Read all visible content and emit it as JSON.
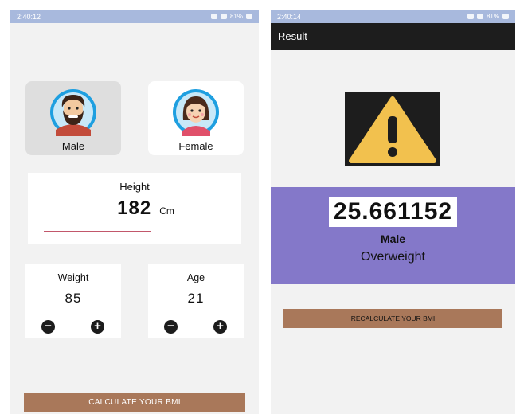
{
  "left_screen": {
    "status_time": "2:40:12",
    "status_battery": "81%",
    "gender_options": [
      {
        "label": "Male",
        "selected": true
      },
      {
        "label": "Female",
        "selected": false
      }
    ],
    "height": {
      "title": "Height",
      "value": "182",
      "unit": "Cm"
    },
    "weight": {
      "title": "Weight",
      "value": "85"
    },
    "age": {
      "title": "Age",
      "value": "21"
    },
    "calculate_label": "CALCULATE YOUR BMI"
  },
  "right_screen": {
    "status_time": "2:40:14",
    "status_battery": "81%",
    "title": "Result",
    "bmi_value": "25.661152",
    "gender": "Male",
    "status": "Overweight",
    "recalculate_label": "RECALCULATE YOUR BMI"
  },
  "colors": {
    "accent_button": "#a9785a",
    "result_panel": "#8478c9",
    "slider": "#c2576b",
    "warning": "#f2c14e"
  },
  "icons": [
    "male-avatar-icon",
    "female-avatar-icon",
    "minus-icon",
    "plus-icon",
    "warning-icon",
    "wifi-icon",
    "signal-icon",
    "battery-icon"
  ]
}
